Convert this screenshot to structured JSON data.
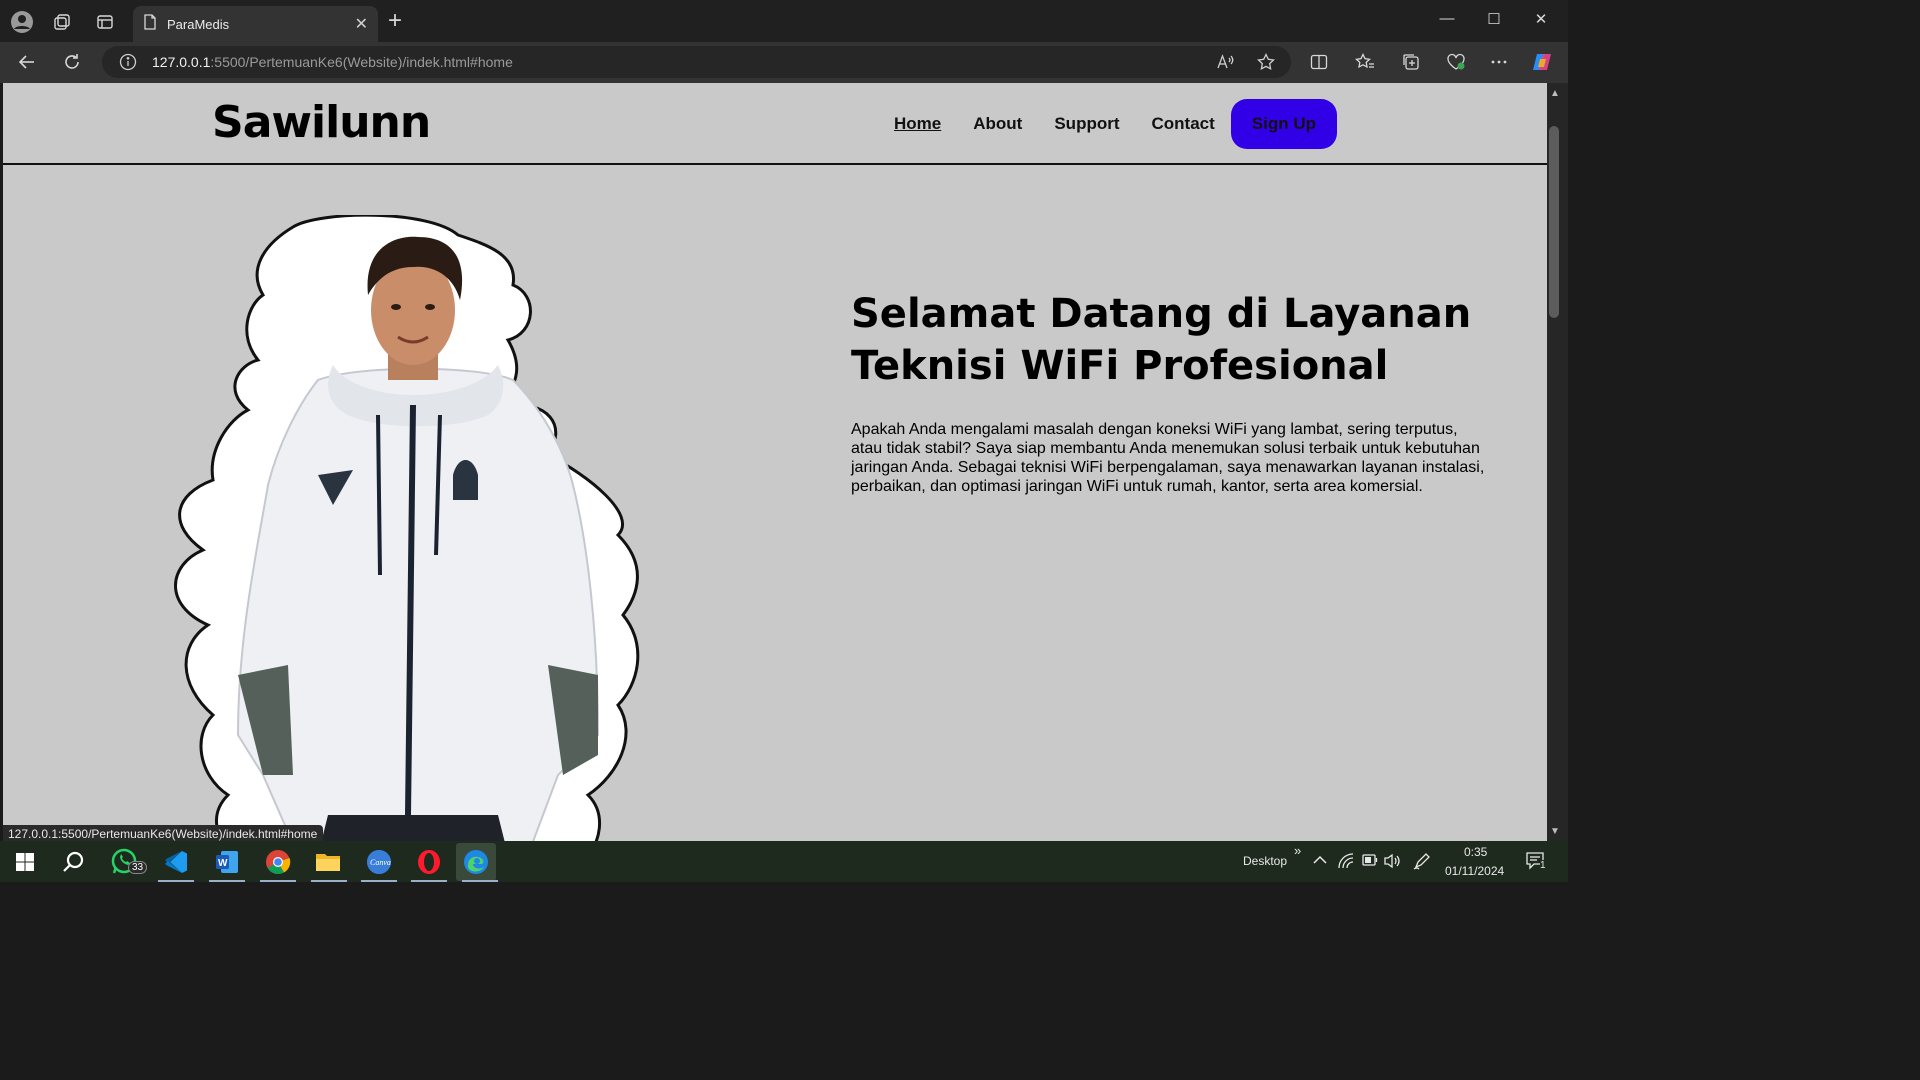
{
  "browser": {
    "tab_title": "ParaMedis",
    "url_host": "127.0.0.1",
    "url_rest": ":5500/PertemuanKe6(Website)/indek.html#home"
  },
  "site": {
    "logo": "Sawilunn",
    "nav": {
      "home": "Home",
      "about": "About",
      "support": "Support",
      "contact": "Contact",
      "signup": "Sign Up"
    },
    "hero": {
      "title": "Selamat Datang di Layanan Teknisi WiFi Profesional",
      "description": "Apakah Anda mengalami masalah dengan koneksi WiFi yang lambat, sering terputus, atau tidak stabil? Saya siap membantu Anda menemukan solusi terbaik untuk kebutuhan jaringan Anda. Sebagai teknisi WiFi berpengalaman, saya menawarkan layanan instalasi, perbaikan, dan optimasi jaringan WiFi untuk rumah, kantor, serta area komersial."
    },
    "accent_color": "#3200e6",
    "background_color": "#c9c9c9"
  },
  "status_url": "127.0.0.1:5500/PertemuanKe6(Website)/indek.html#home",
  "taskbar": {
    "whatsapp_badge": "33",
    "desktop_label": "Desktop",
    "time": "0:35",
    "date": "01/11/2024",
    "notification_count": "1"
  }
}
